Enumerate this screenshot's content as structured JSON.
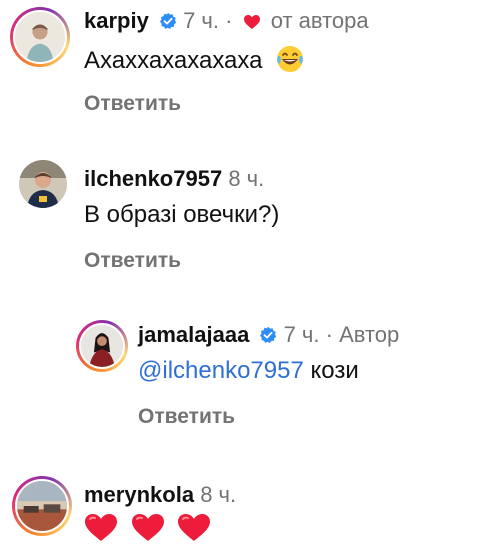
{
  "comments": [
    {
      "username": "karpiy",
      "verified": true,
      "time": "7 ч.",
      "dot": "·",
      "note": "от автора",
      "text": "Ахаххахахахаха",
      "emoji": "laughing-tears",
      "reply_label": "Ответить"
    },
    {
      "username": "ilchenko7957",
      "verified": false,
      "time": "8 ч.",
      "text": "В образі овечки?)",
      "reply_label": "Ответить"
    },
    {
      "username": "jamalajaaa",
      "verified": true,
      "time": "7 ч.",
      "dot": "·",
      "note": "Автор",
      "mention": "@ilchenko7957",
      "text": "кози",
      "reply_label": "Ответить"
    },
    {
      "username": "merynkola",
      "verified": false,
      "time": "8 ч.",
      "emoji": "three-red-hearts"
    }
  ],
  "colors": {
    "text": "#111111",
    "muted": "#737373",
    "mention": "#2f6fd6",
    "heart": "#ed1c3b",
    "verified": "#2f8df6"
  }
}
